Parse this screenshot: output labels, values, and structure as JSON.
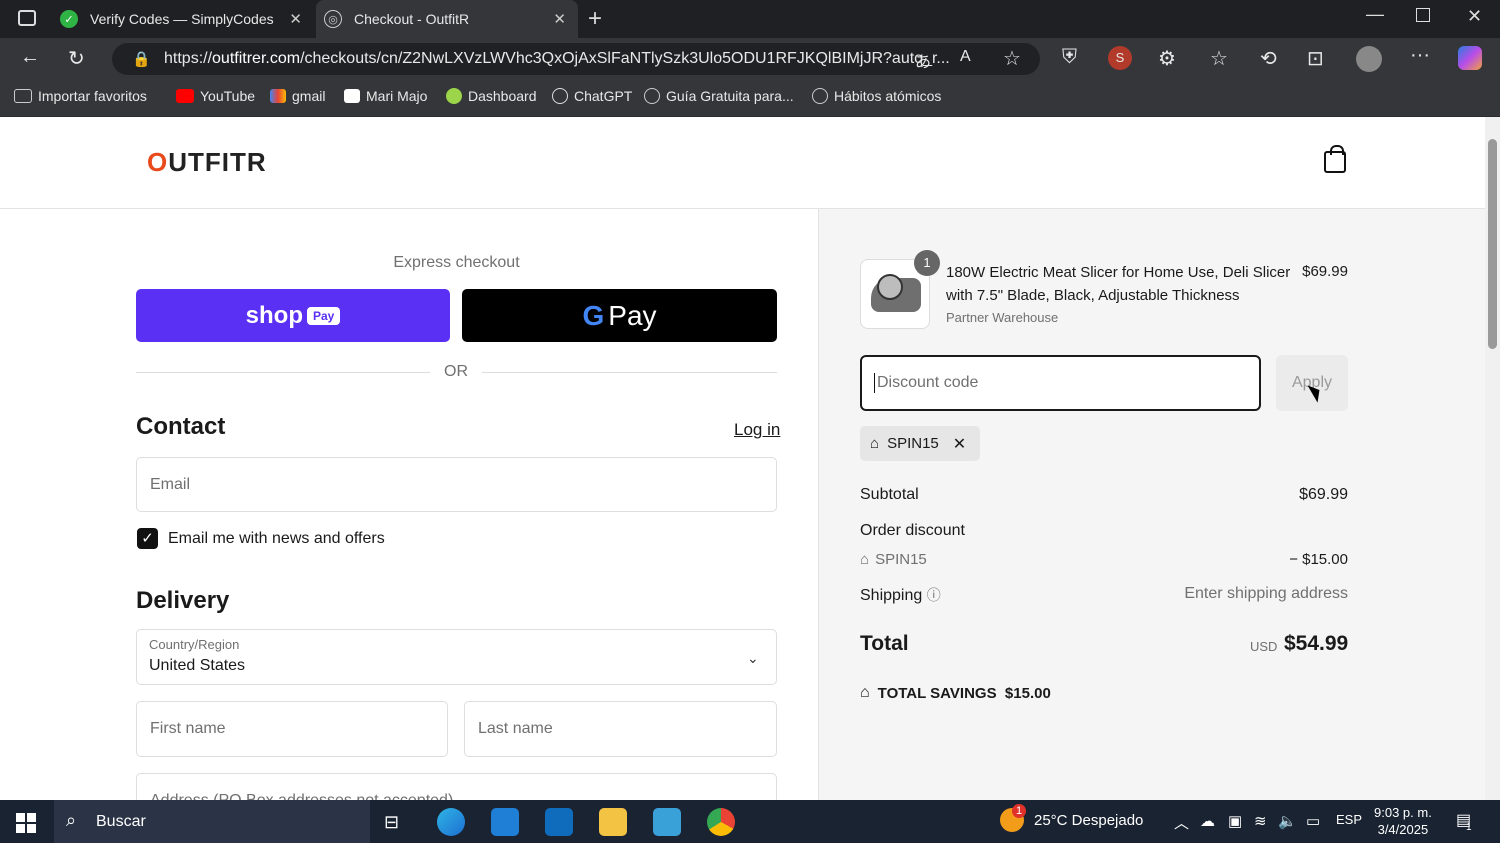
{
  "browser": {
    "tabs": [
      {
        "title": "Verify Codes — SimplyCodes",
        "active": false
      },
      {
        "title": "Checkout - OutfitR",
        "active": true
      }
    ],
    "url_prefix": "https://",
    "url_domain": "outfitrer.com",
    "url_rest": "/checkouts/cn/Z2NwLXVzLWVhc3QxOjAxSlFaNTlySzk3Ulo5ODU1RFJKQlBIMjJR?auto_r...",
    "bookmarks": [
      "Importar favoritos",
      "YouTube",
      "gmail",
      "Mari Majo",
      "Dashboard",
      "ChatGPT",
      "Guía Gratuita para...",
      "Hábitos atómicos"
    ]
  },
  "store": {
    "logo_text": "OUTFITR"
  },
  "checkout": {
    "express_label": "Express checkout",
    "shoppay_label": "shop",
    "shoppay_badge": "Pay",
    "gpay_g": "G",
    "gpay_label": "Pay",
    "or_label": "OR",
    "contact_heading": "Contact",
    "login_link": "Log in",
    "email_placeholder": "Email",
    "newsletter_label": "Email me with news and offers",
    "newsletter_checked": true,
    "delivery_heading": "Delivery",
    "country_label": "Country/Region",
    "country_value": "United States",
    "first_name_placeholder": "First name",
    "last_name_placeholder": "Last name",
    "address_placeholder": "Address (PO Box addresses not accepted)"
  },
  "summary": {
    "quantity": "1",
    "product_name": "180W Electric Meat Slicer for Home Use, Deli Slicer with 7.5\" Blade, Black, Adjustable Thickness",
    "vendor": "Partner Warehouse",
    "product_price": "$69.99",
    "discount_placeholder": "Discount code",
    "apply_label": "Apply",
    "applied_code": "SPIN15",
    "subtotal_label": "Subtotal",
    "subtotal_value": "$69.99",
    "order_discount_label": "Order discount",
    "discount_code_label": "SPIN15",
    "discount_value": "− $15.00",
    "shipping_label": "Shipping",
    "shipping_value": "Enter shipping address",
    "total_label": "Total",
    "total_currency": "USD",
    "total_value": "$54.99",
    "savings_label": "TOTAL SAVINGS",
    "savings_value": "$15.00"
  },
  "taskbar": {
    "search_placeholder": "Buscar",
    "weather": "25°C Despejado",
    "weather_badge": "1",
    "language": "ESP",
    "time": "9:03 p. m.",
    "date": "3/4/2025",
    "notifications": "1"
  },
  "colors": {
    "shoppay": "#5a31f4",
    "logo_accent": "#e84a1b",
    "taskbar": "#1a2332"
  }
}
